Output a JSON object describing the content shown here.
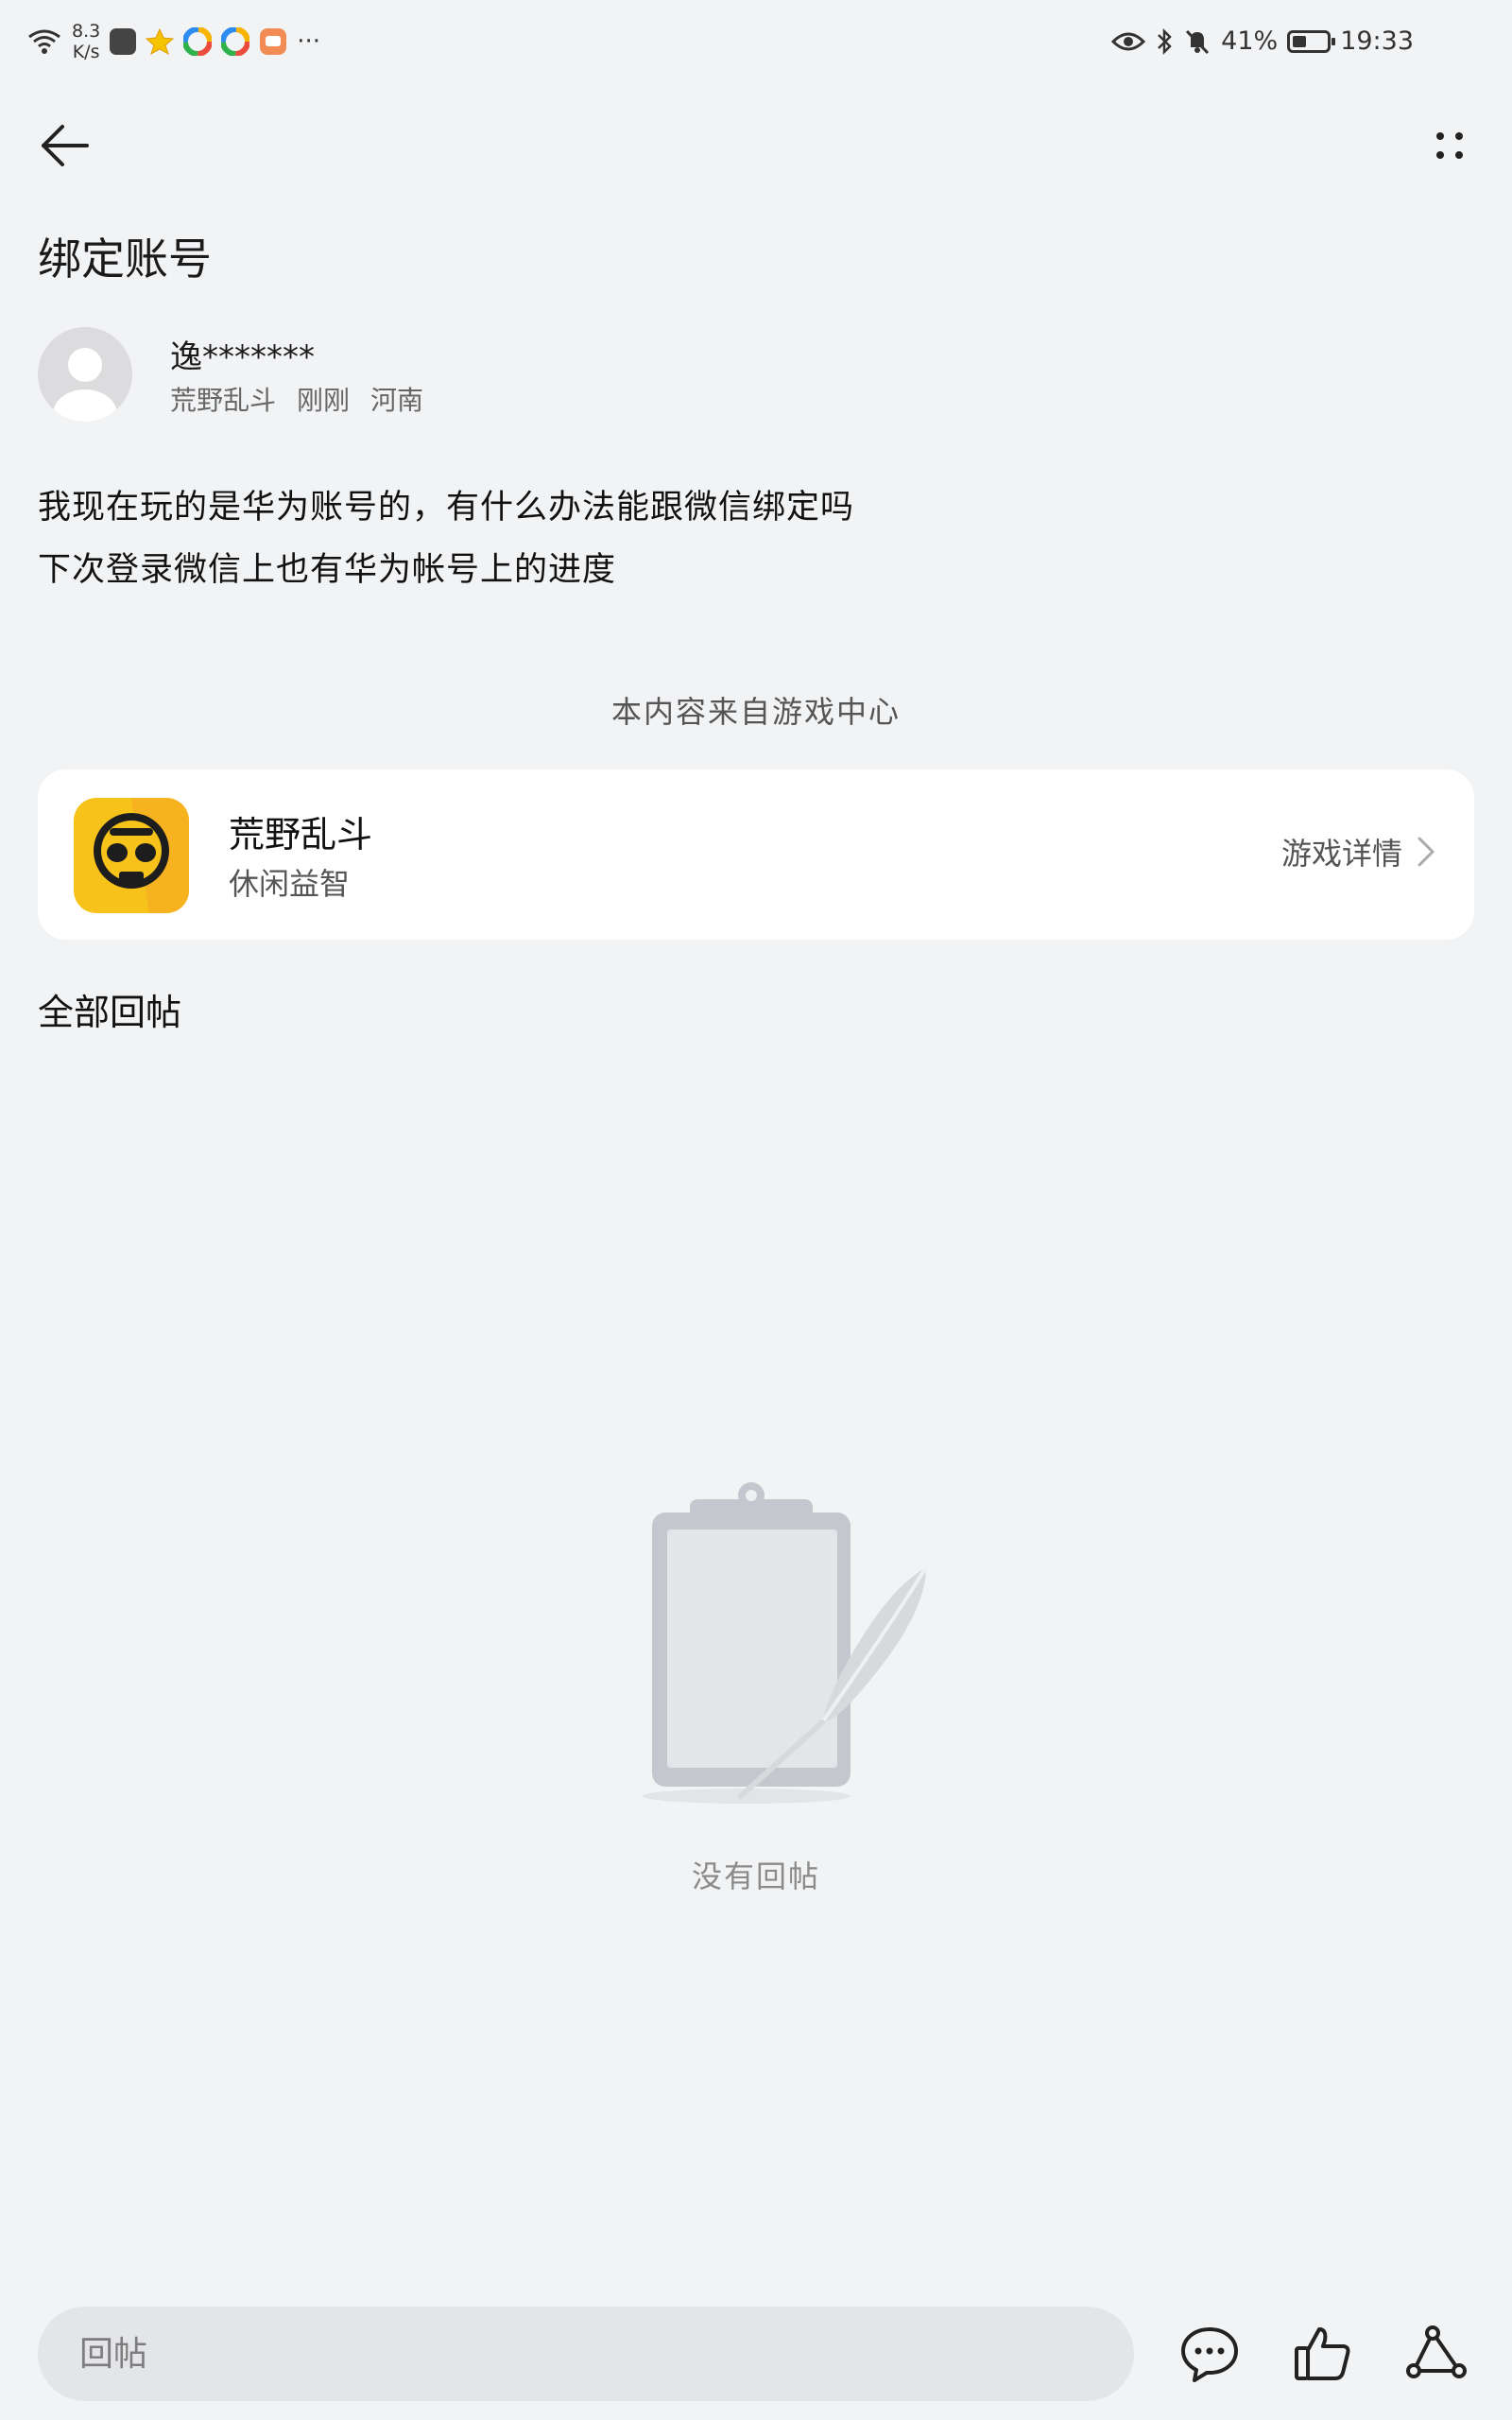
{
  "status_bar": {
    "net_speed_value": "8.3",
    "net_speed_unit": "K/s",
    "more_notifications": "···",
    "battery_percent": "41%",
    "battery_level": 0.41,
    "time": "19:33"
  },
  "post": {
    "title": "绑定账号",
    "author_name": "逸*******",
    "meta_game": "荒野乱斗",
    "meta_time": "刚刚",
    "meta_location": "河南",
    "body_lines": [
      "我现在玩的是华为账号的，有什么办法能跟微信绑定吗",
      "下次登录微信上也有华为帐号上的进度"
    ]
  },
  "source_note": "本内容来自游戏中心",
  "game_card": {
    "name": "荒野乱斗",
    "genre": "休闲益智",
    "detail_label": "游戏详情"
  },
  "replies": {
    "section_title": "全部回帖",
    "empty_text": "没有回帖"
  },
  "bottom_bar": {
    "reply_placeholder": "回帖"
  },
  "colors": {
    "background": "#f2f3f5",
    "card": "#ffffff",
    "game_icon_yellow": "#f7c21a"
  }
}
